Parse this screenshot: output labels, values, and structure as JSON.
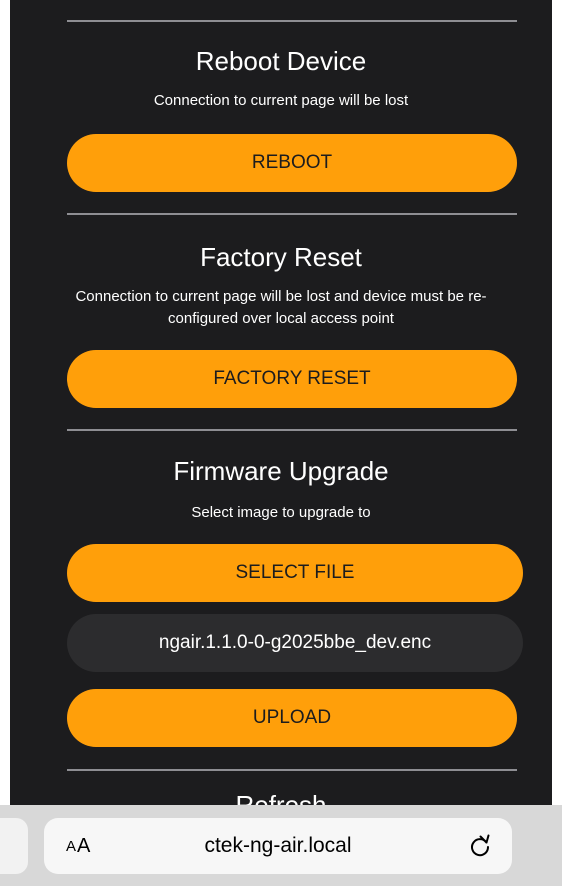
{
  "sections": [
    {
      "title": "Reboot Device",
      "description": "Connection to current page will be lost",
      "button_label": "REBOOT"
    },
    {
      "title": "Factory Reset",
      "description": "Connection to current page will be lost and device must be re-configured over local access point",
      "button_label": "FACTORY RESET"
    },
    {
      "title": "Firmware Upgrade",
      "description": "Select image to upgrade to",
      "select_label": "SELECT FILE",
      "selected_file": "ngair.1.1.0-0-g2025bbe_dev.enc",
      "upload_label": "UPLOAD"
    }
  ],
  "next_section_title": "Refresh",
  "browser": {
    "text_size_small": "A",
    "text_size_large": "A",
    "url": "ctek-ng-air.local",
    "reload_icon": "reload-icon"
  },
  "colors": {
    "background": "#1c1c1e",
    "accent": "#ff9f0a",
    "file_field": "#2c2c2e",
    "divider": "#8e8e93"
  }
}
